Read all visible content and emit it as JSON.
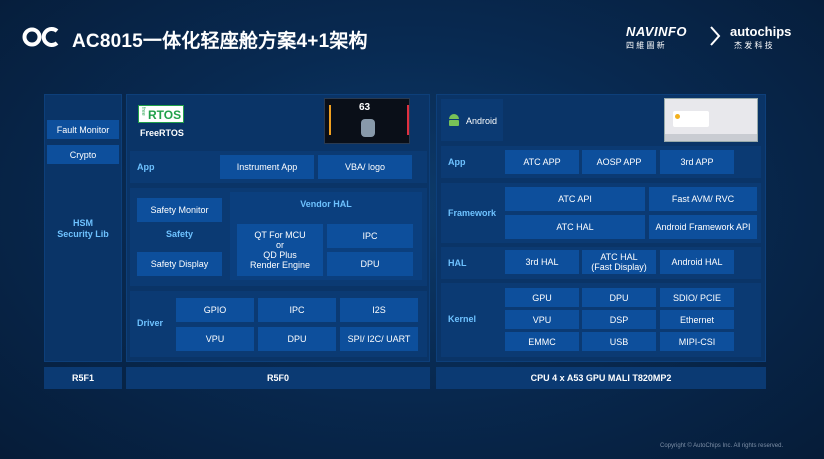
{
  "header": {
    "logo_left": "OC",
    "title": "AC8015一体化轻座舱方案4+1架构",
    "navinfo": "NAVINFO",
    "navinfo_cn": "四 維 圖 新",
    "autochips": "autochips",
    "autochips_cn": "杰 发 科 技"
  },
  "hsm": {
    "fault_monitor": "Fault Monitor",
    "crypto": "Crypto",
    "lib_line1": "HSM",
    "lib_line2": "Security Lib"
  },
  "freertos": {
    "logo_free": "free",
    "logo_rtos": "RTOS",
    "label": "FreeRTOS",
    "gauge_speed": "63",
    "app_label": "App",
    "instrument_app": "Instrument App",
    "vba_logo": "VBA/ logo",
    "safety_monitor": "Safety Monitor",
    "safety": "Safety",
    "safety_display": "Safety Display",
    "vendor_hal": "Vendor HAL",
    "qt_l1": "QT For MCU",
    "qt_l2": "or",
    "qt_l3": "QD Plus",
    "qt_l4": "Render Engine",
    "ipc": "IPC",
    "dpu": "DPU",
    "driver_label": "Driver",
    "driver_cells": [
      "GPIO",
      "IPC",
      "I2S",
      "VPU",
      "DPU",
      "SPI/ I2C/ UART"
    ]
  },
  "android": {
    "label": "Android",
    "app_label": "App",
    "apps": [
      "ATC APP",
      "AOSP APP",
      "3rd APP"
    ],
    "framework_label": "Framework",
    "framework": [
      "ATC API",
      "Fast AVM/ RVC",
      "ATC HAL",
      "Android Framework API"
    ],
    "hal_label": "HAL",
    "hal_cells": [
      "3rd HAL",
      "Android  HAL"
    ],
    "atc_hal_l1": "ATC HAL",
    "atc_hal_l2": "(Fast Display)",
    "kernel_label": "Kernel",
    "kernel_cells": [
      "GPU",
      "DPU",
      "SDIO/ PCIE",
      "VPU",
      "DSP",
      "Ethernet",
      "EMMC",
      "USB",
      "MIPI-CSI"
    ]
  },
  "bottom": {
    "r5f1": "R5F1",
    "r5f0": "R5F0",
    "cpu": "CPU 4 x A53 GPU MALI T820MP2"
  },
  "copyright": "Copyright © AutoChips Inc.  All rights reserved."
}
